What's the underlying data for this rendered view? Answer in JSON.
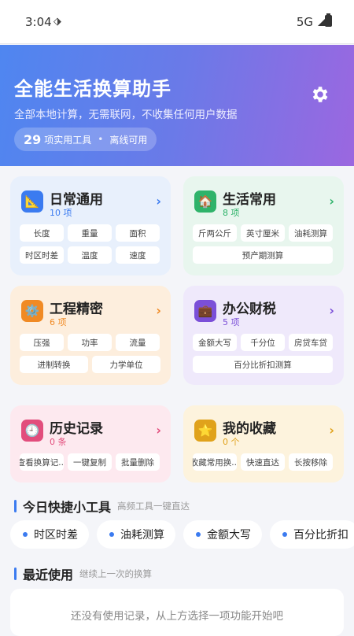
{
  "status": {
    "time": "3:04",
    "network": "5G"
  },
  "hero": {
    "title": "全能生活换算助手",
    "subtitle": "全部本地计算，无需联网，不收集任何用户数据",
    "count": "29",
    "count_suffix": "项实用工具",
    "separator": "•",
    "offline": "离线可用"
  },
  "cards": [
    {
      "title": "日常通用",
      "count": "10 项",
      "icon": "📐",
      "items": [
        "长度",
        "重量",
        "面积",
        "时区时差",
        "温度",
        "速度"
      ]
    },
    {
      "title": "生活常用",
      "count": "8 项",
      "icon": "🏠",
      "items": [
        "斤两公斤",
        "英寸厘米",
        "油耗测算",
        "预产期测算"
      ]
    },
    {
      "title": "工程精密",
      "count": "6 项",
      "icon": "⚙️",
      "items": [
        "压强",
        "功率",
        "流量",
        "进制转换",
        "力学单位"
      ]
    },
    {
      "title": "办公财税",
      "count": "5 项",
      "icon": "💼",
      "items": [
        "金额大写",
        "千分位",
        "房贷车贷",
        "百分比折扣测算"
      ]
    },
    {
      "title": "历史记录",
      "count": "0 条",
      "icon": "🕘",
      "items": [
        "查看换算记...",
        "一键复制",
        "批量删除"
      ]
    },
    {
      "title": "我的收藏",
      "count": "0 个",
      "icon": "⭐",
      "items": [
        "收藏常用换...",
        "快速直达",
        "长按移除"
      ]
    }
  ],
  "quick": {
    "title": "今日快捷小工具",
    "desc": "高频工具一键直达",
    "items": [
      "时区时差",
      "油耗测算",
      "金额大写",
      "百分比折扣"
    ]
  },
  "recent": {
    "title": "最近使用",
    "desc": "继续上一次的换算",
    "empty": "还没有使用记录，从上方选择一项功能开始吧"
  },
  "colors": {
    "accent": "#3b7bf0",
    "blue": "#3b7bf0",
    "green": "#2fb36a",
    "orange": "#f08a24",
    "purple": "#7b4fd8",
    "pink": "#e24d7c",
    "yellow": "#e0a21b"
  }
}
